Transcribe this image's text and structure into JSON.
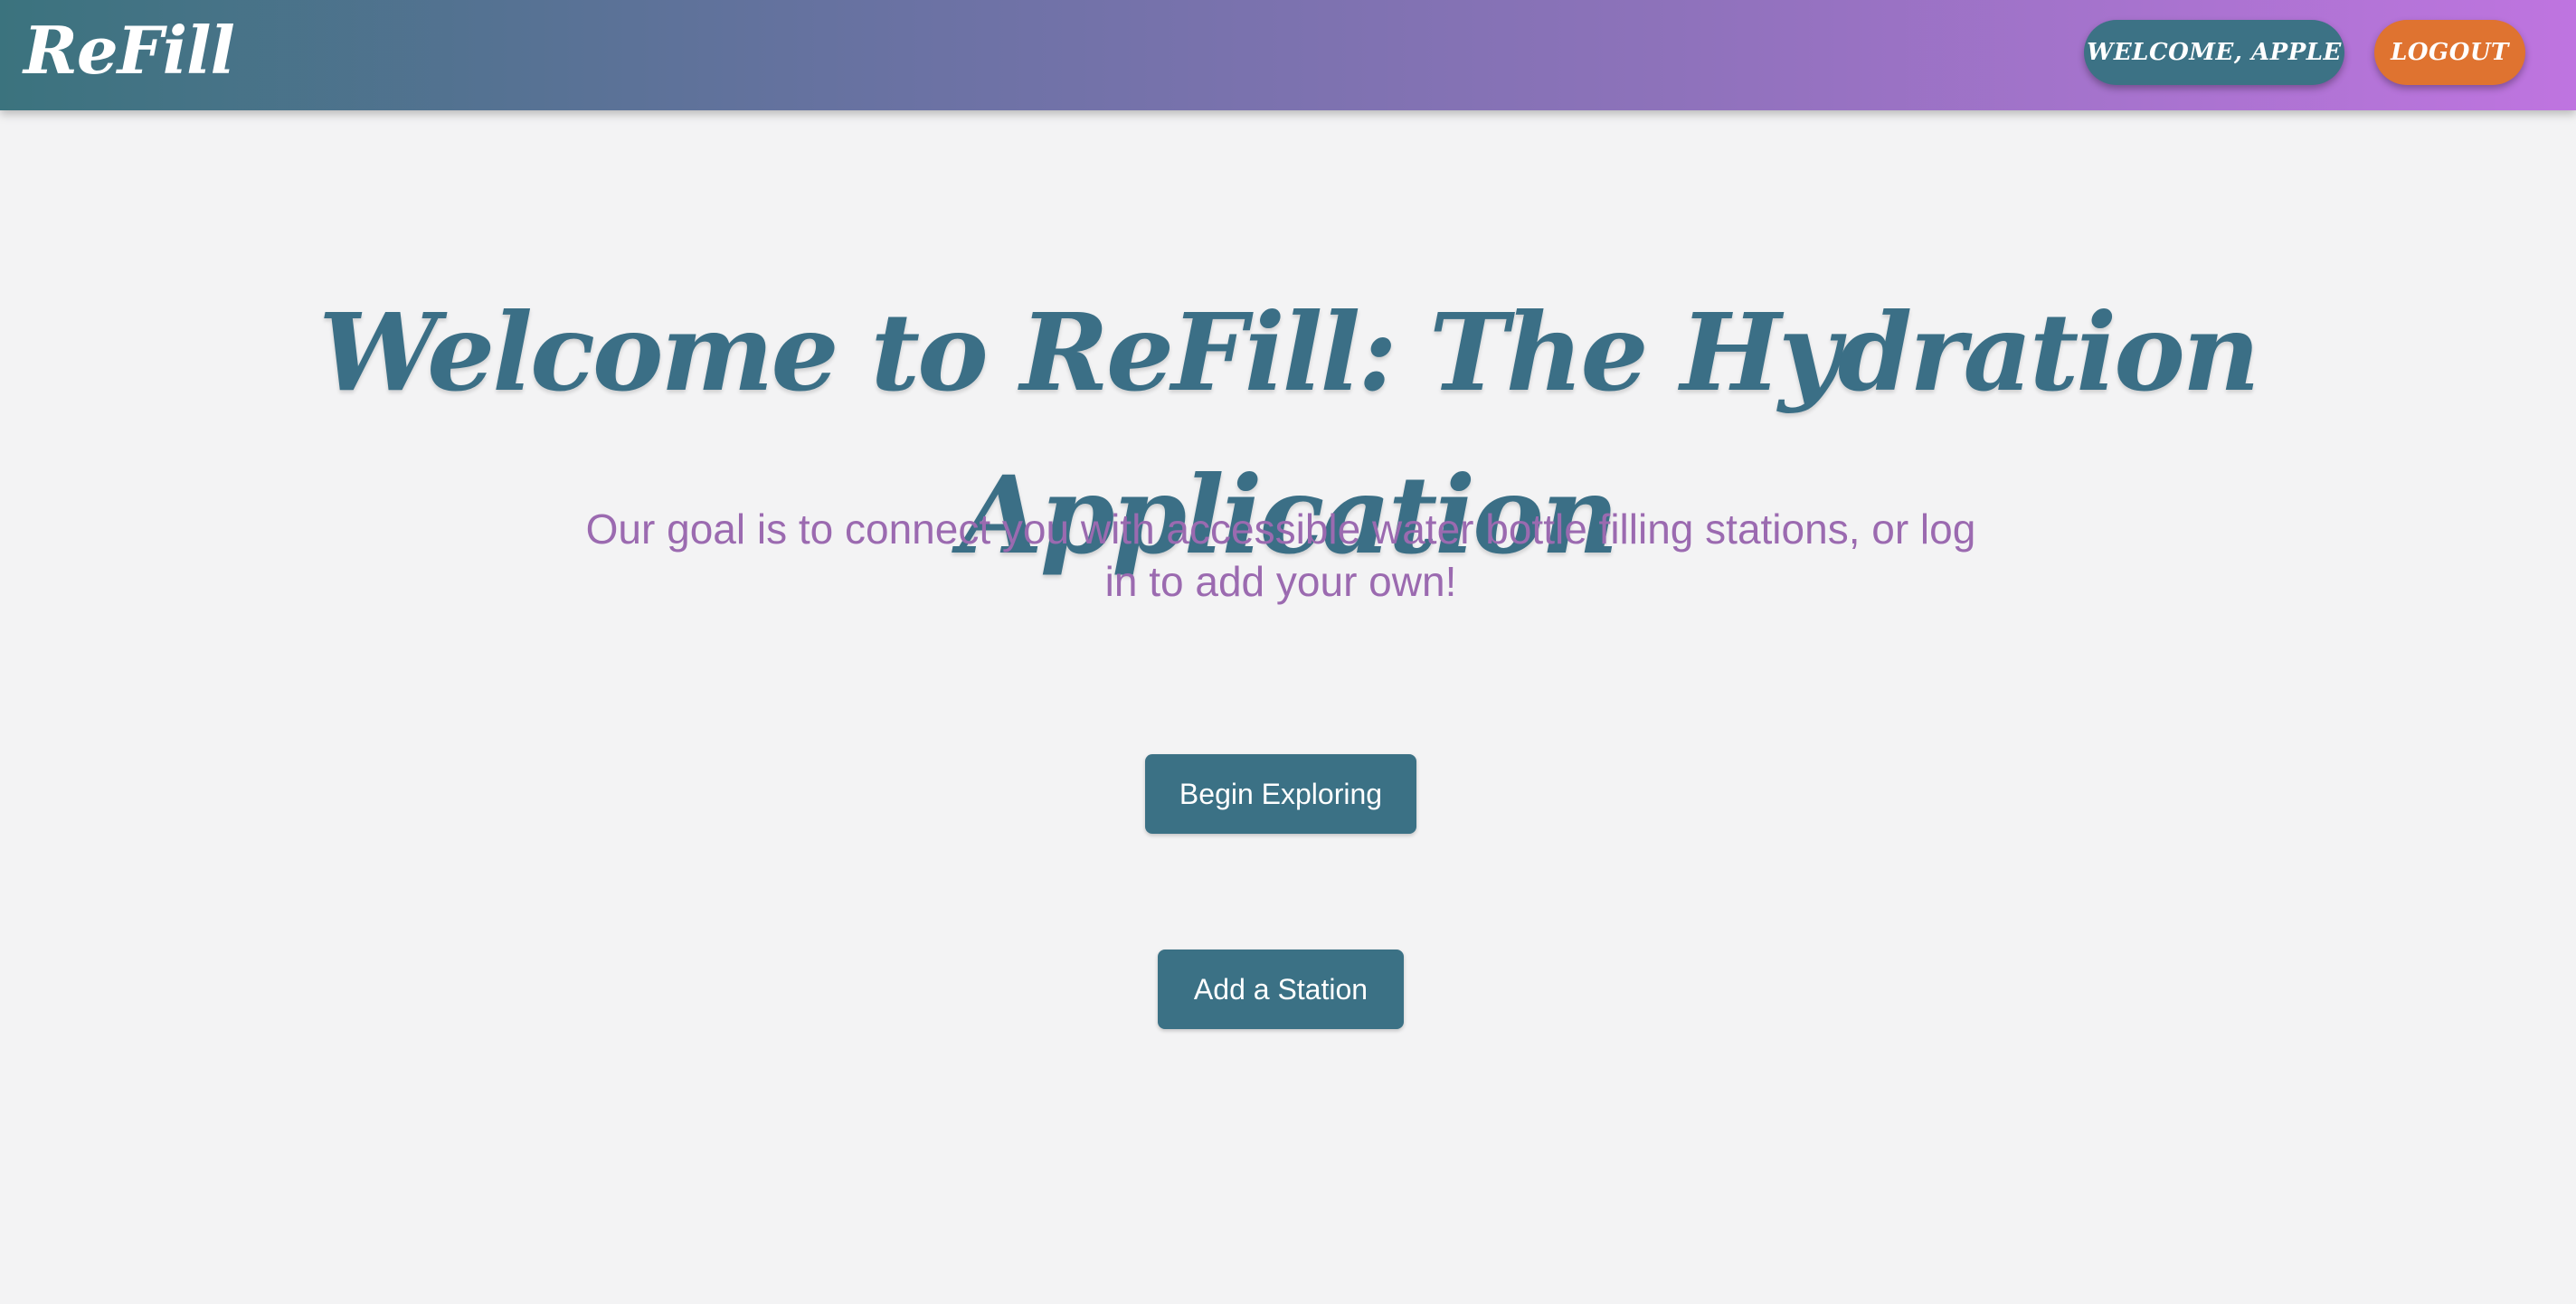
{
  "navbar": {
    "brand": "ReFill",
    "welcome_label": "WELCOME, APPLE",
    "logout_label": "LOGOUT"
  },
  "hero": {
    "title": "Welcome to ReFill: The Hydration Application",
    "subtitle": "Our goal is to connect you with accessible water bottle filling stations, or log in to add your own!"
  },
  "actions": {
    "explore_label": "Begin Exploring",
    "add_station_label": "Add a Station"
  },
  "colors": {
    "primary": "#3b7185",
    "accent_orange": "#df7330",
    "subtitle_purple": "#9b6ab0",
    "gradient_start": "#3b737e",
    "gradient_end": "#bf74e0"
  }
}
